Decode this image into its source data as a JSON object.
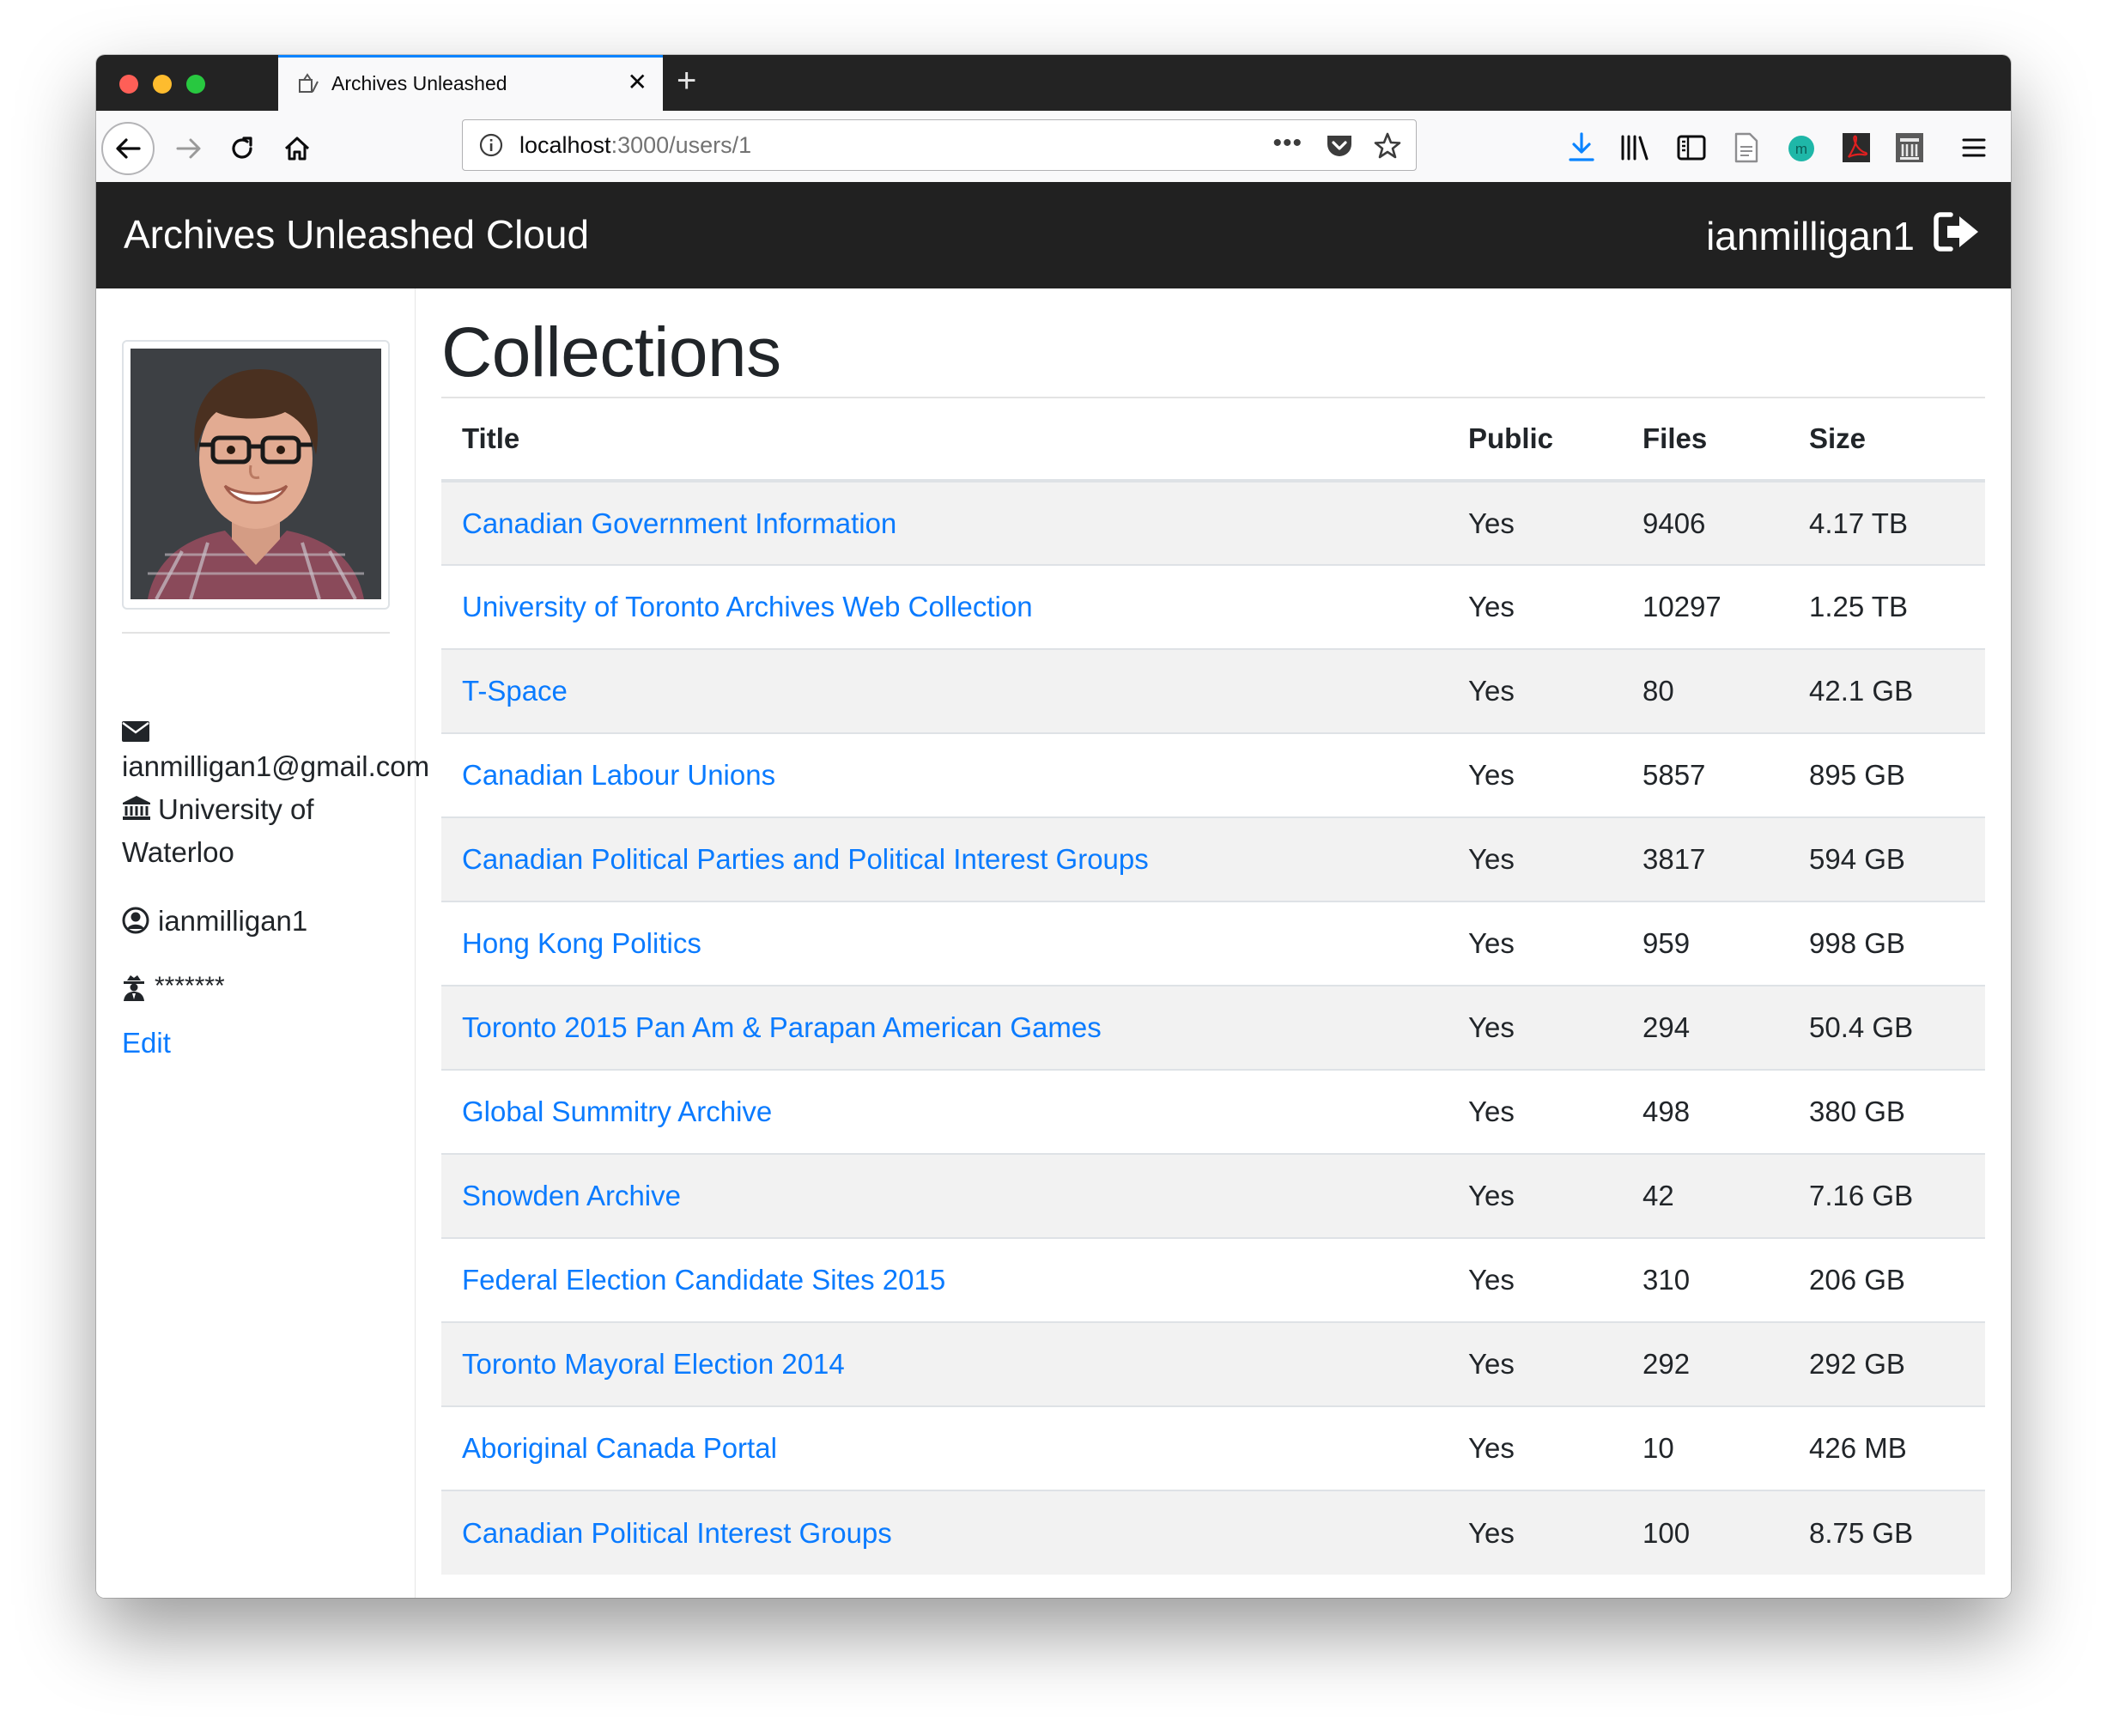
{
  "browser": {
    "tab_title": "Archives Unleashed",
    "url_host": "localhost",
    "url_path": ":3000/users/1"
  },
  "navbar": {
    "brand": "Archives Unleashed Cloud",
    "username": "ianmilligan1"
  },
  "profile": {
    "email": "ianmilligan1@gmail.com",
    "institution_line1": "University of",
    "institution_line2": "Waterloo",
    "username": "ianmilligan1",
    "password": "*******",
    "edit_label": "Edit"
  },
  "collections": {
    "heading": "Collections",
    "columns": [
      "Title",
      "Public",
      "Files",
      "Size"
    ],
    "rows": [
      {
        "title": "Canadian Government Information",
        "public": "Yes",
        "files": "9406",
        "size": "4.17 TB"
      },
      {
        "title": "University of Toronto Archives Web Collection",
        "public": "Yes",
        "files": "10297",
        "size": "1.25 TB"
      },
      {
        "title": "T-Space",
        "public": "Yes",
        "files": "80",
        "size": "42.1 GB"
      },
      {
        "title": "Canadian Labour Unions",
        "public": "Yes",
        "files": "5857",
        "size": "895 GB"
      },
      {
        "title": "Canadian Political Parties and Political Interest Groups",
        "public": "Yes",
        "files": "3817",
        "size": "594 GB"
      },
      {
        "title": "Hong Kong Politics",
        "public": "Yes",
        "files": "959",
        "size": "998 GB"
      },
      {
        "title": "Toronto 2015 Pan Am & Parapan American Games",
        "public": "Yes",
        "files": "294",
        "size": "50.4 GB"
      },
      {
        "title": "Global Summitry Archive",
        "public": "Yes",
        "files": "498",
        "size": "380 GB"
      },
      {
        "title": "Snowden Archive",
        "public": "Yes",
        "files": "42",
        "size": "7.16 GB"
      },
      {
        "title": "Federal Election Candidate Sites 2015",
        "public": "Yes",
        "files": "310",
        "size": "206 GB"
      },
      {
        "title": "Toronto Mayoral Election 2014",
        "public": "Yes",
        "files": "292",
        "size": "292 GB"
      },
      {
        "title": "Aboriginal Canada Portal",
        "public": "Yes",
        "files": "10",
        "size": "426 MB"
      },
      {
        "title": "Canadian Political Interest Groups",
        "public": "Yes",
        "files": "100",
        "size": "8.75 GB"
      }
    ]
  },
  "colors": {
    "navbar_bg": "#212121",
    "link": "#0a7bff",
    "stripe": "#f2f2f2",
    "tab_accent": "#0a84ff"
  }
}
